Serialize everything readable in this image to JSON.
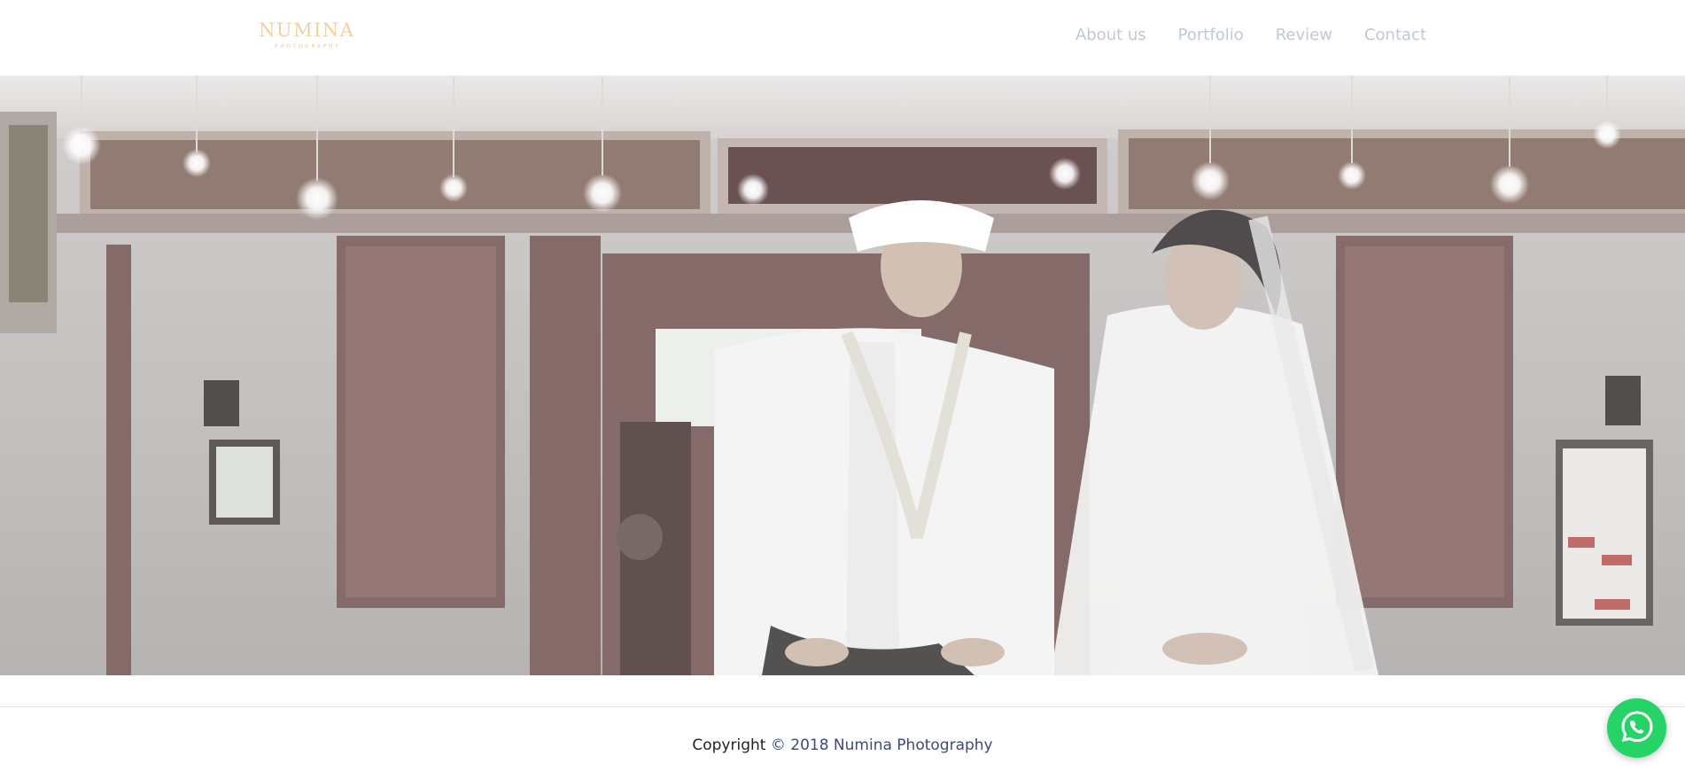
{
  "header": {
    "logo": {
      "title": "NUMINA",
      "subtitle": "PHOTOGRAPHY"
    },
    "nav": [
      {
        "label": "About us"
      },
      {
        "label": "Portfolio"
      },
      {
        "label": "Review"
      },
      {
        "label": "Contact"
      }
    ]
  },
  "hero": {
    "image": "wedding-couple-photo",
    "description_icon": "photo"
  },
  "footer": {
    "copyright_prefix": "Copyright",
    "copyright_rest": "© 2018 Numina Photography"
  },
  "whatsapp": {
    "icon": "whatsapp-icon"
  },
  "colors": {
    "logo": "#f2cf9f",
    "nav_text": "#c2c8d2",
    "whatsapp": "#25d366",
    "footer_accent": "#3b4a7a"
  }
}
